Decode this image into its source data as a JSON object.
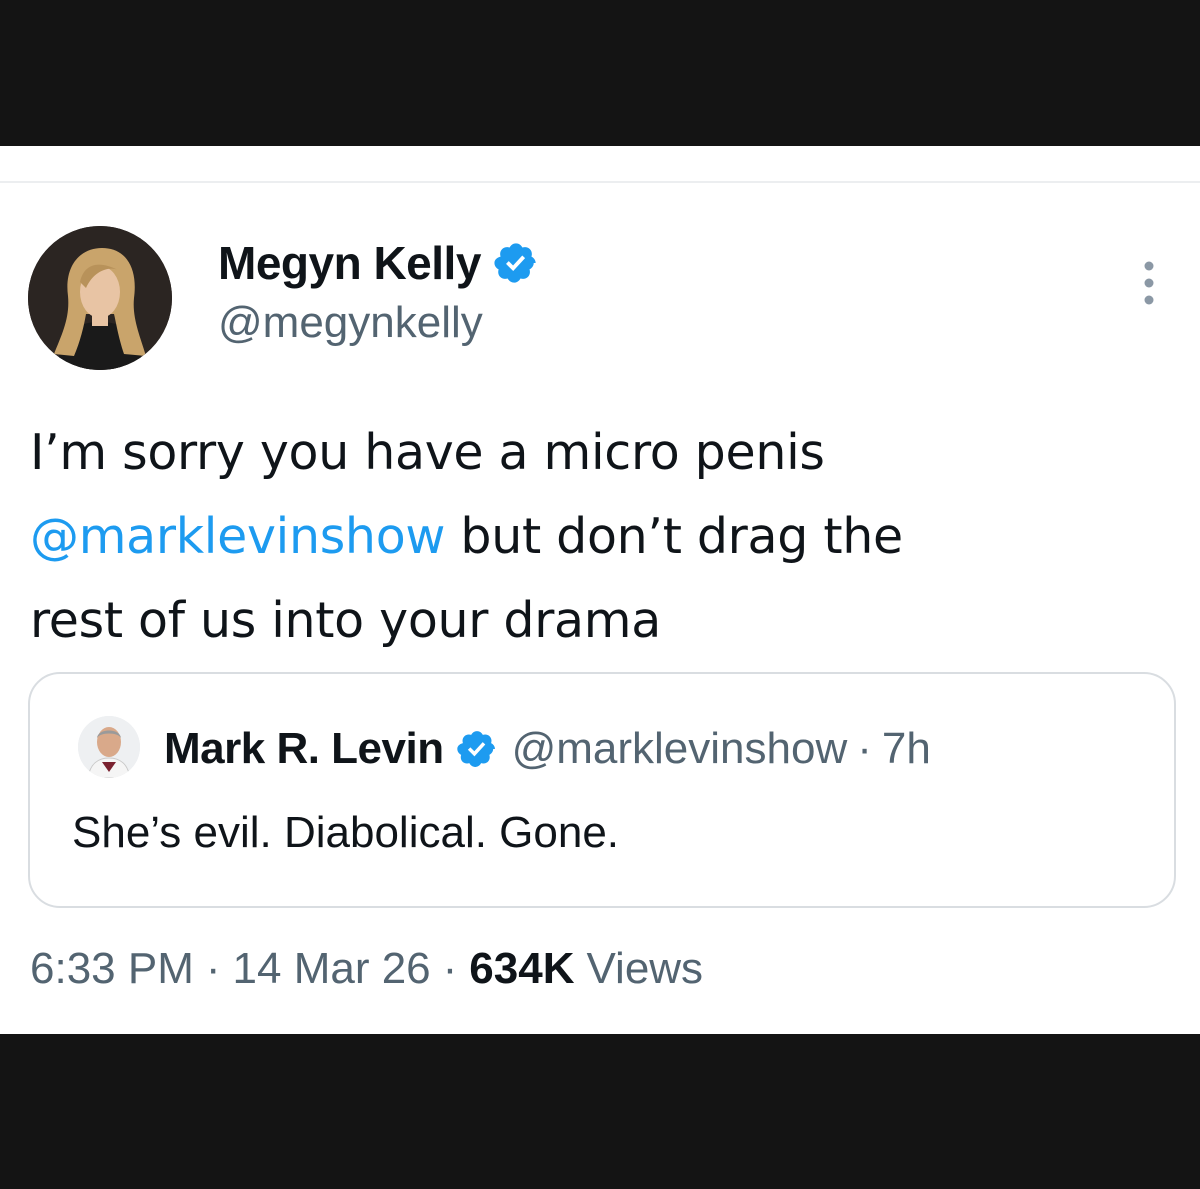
{
  "tweet": {
    "author_name": "Megyn Kelly",
    "author_handle": "@megynkelly",
    "text_line1": "I’m sorry you have a micro penis",
    "mention": "@marklevinshow",
    "text_line2_rest": " but don’t drag the",
    "text_line3": "rest of us into your drama",
    "time": "6:33 PM",
    "date": "14 Mar 26",
    "views_count": "634K",
    "views_label": "Views",
    "separator": "·"
  },
  "quoted": {
    "author_name": "Mark R. Levin",
    "author_handle": "@marklevinshow",
    "separator": "·",
    "time": "7h",
    "text": "She’s evil. Diabolical. Gone."
  },
  "colors": {
    "verified": "#1d9bf0",
    "mention": "#1d9bf0",
    "text": "#0f1419",
    "secondary": "#536471"
  },
  "icons": {
    "verified": "verified-badge-icon",
    "more": "more-options-icon"
  }
}
